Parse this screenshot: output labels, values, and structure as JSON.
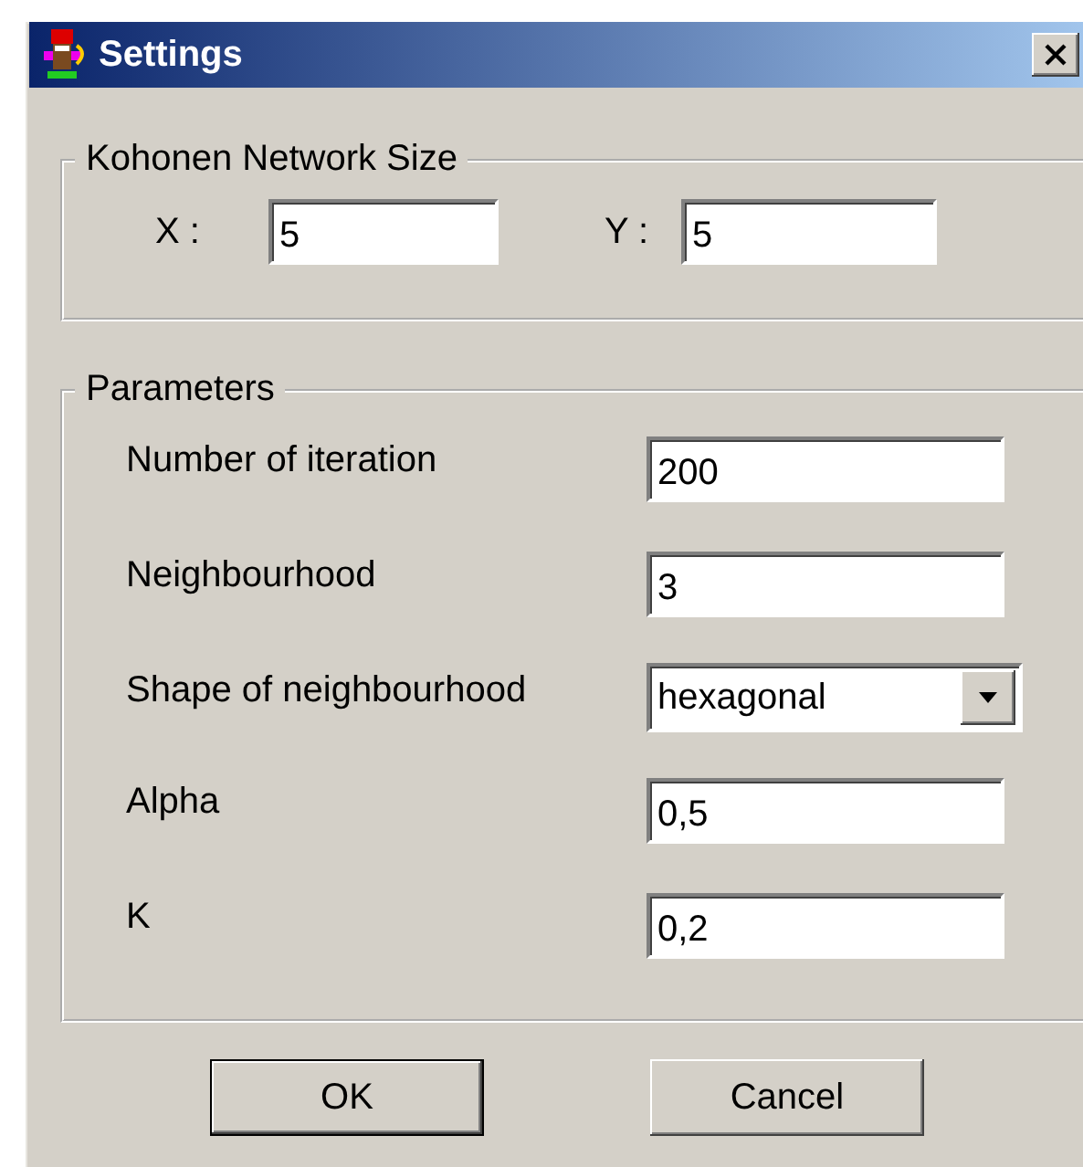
{
  "window": {
    "title": "Settings"
  },
  "network_size": {
    "title": "Kohonen Network Size",
    "fields": [
      {
        "label": "X :",
        "value": "5"
      },
      {
        "label": "Y :",
        "value": "5"
      }
    ]
  },
  "parameters": {
    "title": "Parameters",
    "rows": [
      {
        "kind": "text",
        "label": "Number of iteration",
        "value": "200"
      },
      {
        "kind": "text",
        "label": "Neighbourhood",
        "value": "3"
      },
      {
        "kind": "dropdown",
        "label": "Shape of neighbourhood",
        "value": "hexagonal"
      },
      {
        "kind": "text",
        "label": "Alpha",
        "value": "0,5"
      },
      {
        "kind": "text",
        "label": "K",
        "value": "0,2"
      }
    ]
  },
  "buttons": [
    {
      "label": "OK",
      "default": true
    },
    {
      "label": "Cancel",
      "default": false
    }
  ]
}
